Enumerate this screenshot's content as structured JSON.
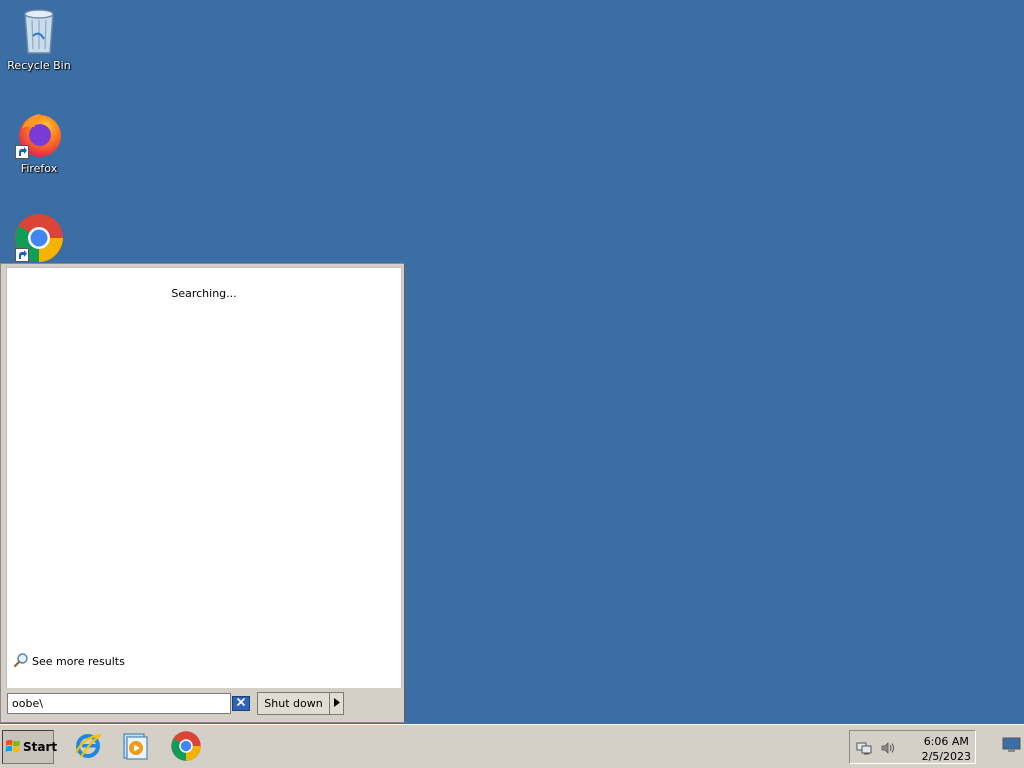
{
  "desktop": {
    "icons": [
      {
        "label": "Recycle Bin",
        "icon": "recycle-bin-icon"
      },
      {
        "label": "Firefox",
        "icon": "firefox-icon"
      },
      {
        "label": "",
        "icon": "chrome-icon"
      }
    ]
  },
  "start_menu": {
    "status_text": "Searching...",
    "see_more_label": "See more results",
    "search": {
      "value": "oobe\\",
      "placeholder": ""
    },
    "shutdown_label": "Shut down",
    "shutdown_arrow_icon": "triangle-right-icon",
    "clear_icon": "clear-search-icon"
  },
  "taskbar": {
    "start_label": "Start",
    "quick_launch": [
      {
        "icon": "internet-explorer-icon"
      },
      {
        "icon": "media-player-icon"
      },
      {
        "icon": "chrome-icon"
      }
    ],
    "tray": {
      "icons": [
        "network-icon",
        "volume-icon"
      ],
      "time": "6:06 AM",
      "date": "2/5/2023"
    }
  },
  "colors": {
    "desktop_bg": "#3a6ea5",
    "chrome_panel": "#d4d0c8",
    "accent_blue": "#2f63b8"
  }
}
